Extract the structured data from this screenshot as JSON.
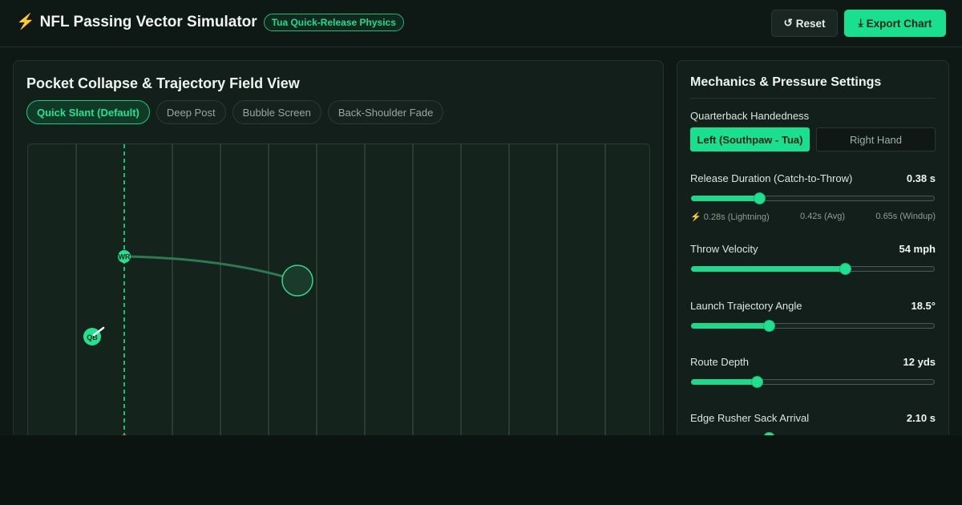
{
  "header": {
    "bolt_glyph": "⚡",
    "title": "NFL Passing Vector Simulator",
    "badge": "Tua Quick-Release Physics",
    "reset_label": "Reset",
    "reset_icon": "↺",
    "export_label": "Export Chart",
    "export_icon": "⤓"
  },
  "field_panel": {
    "title": "Pocket Collapse & Trajectory Field View",
    "tabs": [
      {
        "label": "Quick Slant (Default)",
        "active": true
      },
      {
        "label": "Deep Post",
        "active": false
      },
      {
        "label": "Bubble Screen",
        "active": false
      },
      {
        "label": "Back-Shoulder Fade",
        "active": false
      }
    ],
    "field": {
      "wr_label": "WR",
      "qb_label": "QB"
    }
  },
  "settings": {
    "title": "Mechanics & Pressure Settings",
    "handedness": {
      "label": "Quarterback Handedness",
      "options": [
        "Left (Southpaw - Tua)",
        "Right Hand"
      ],
      "selected": "Left (Southpaw - Tua)"
    },
    "release": {
      "label": "Release Duration (Catch-to-Throw)",
      "value": "0.38 s",
      "level": 0.28,
      "scale": [
        "⚡ 0.28s (Lightning)",
        "0.42s (Avg)",
        "0.65s (Windup)"
      ]
    },
    "velocity": {
      "label": "Throw Velocity",
      "value": "54 mph",
      "level": 0.63
    },
    "angle": {
      "label": "Launch Trajectory Angle",
      "value": "18.5°",
      "level": 0.32
    },
    "depth": {
      "label": "Route Depth",
      "value": "12 yds",
      "level": 0.27
    },
    "sack": {
      "label": "Edge Rusher Sack Arrival",
      "value": "2.10 s",
      "level": 0.32
    }
  },
  "colors": {
    "accent": "#19e08f",
    "field_line": "#2a3d34",
    "trajectory": "#2d7a52",
    "rusher": "#e05a5a"
  }
}
